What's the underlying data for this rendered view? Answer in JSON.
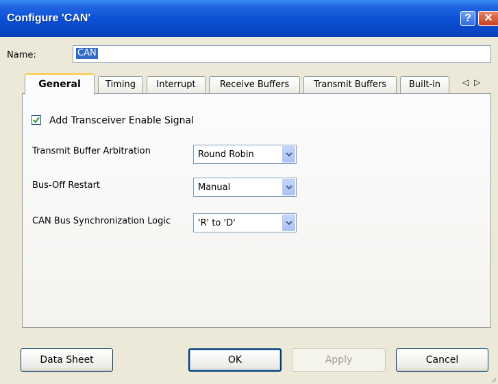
{
  "window": {
    "title": "Configure 'CAN'",
    "help_glyph": "?",
    "close_glyph": "✕"
  },
  "name": {
    "label": "Name:",
    "value": "CAN"
  },
  "tabs": [
    {
      "label": "General",
      "active": true
    },
    {
      "label": "Timing",
      "active": false
    },
    {
      "label": "Interrupt",
      "active": false
    },
    {
      "label": "Receive Buffers",
      "active": false
    },
    {
      "label": "Transmit Buffers",
      "active": false
    },
    {
      "label": "Built-in",
      "active": false
    }
  ],
  "tab_scroll": {
    "left": "◁",
    "right": "▷"
  },
  "general": {
    "transceiver_checkbox": {
      "label": "Add Transceiver Enable Signal",
      "checked": true
    },
    "transmit_buffer_arbitration": {
      "label": "Transmit Buffer Arbitration",
      "value": "Round Robin"
    },
    "bus_off_restart": {
      "label": "Bus-Off Restart",
      "value": "Manual"
    },
    "can_bus_sync_logic": {
      "label": "CAN Bus Synchronization Logic",
      "value": "'R' to 'D'"
    }
  },
  "buttons": {
    "data_sheet": "Data Sheet",
    "ok": "OK",
    "apply": "Apply",
    "cancel": "Cancel"
  },
  "colors": {
    "titlebar": "#0a4fd4",
    "dialog_bg": "#ece9d8",
    "selection": "#316ac5",
    "tab_highlight": "#ffc83c"
  }
}
